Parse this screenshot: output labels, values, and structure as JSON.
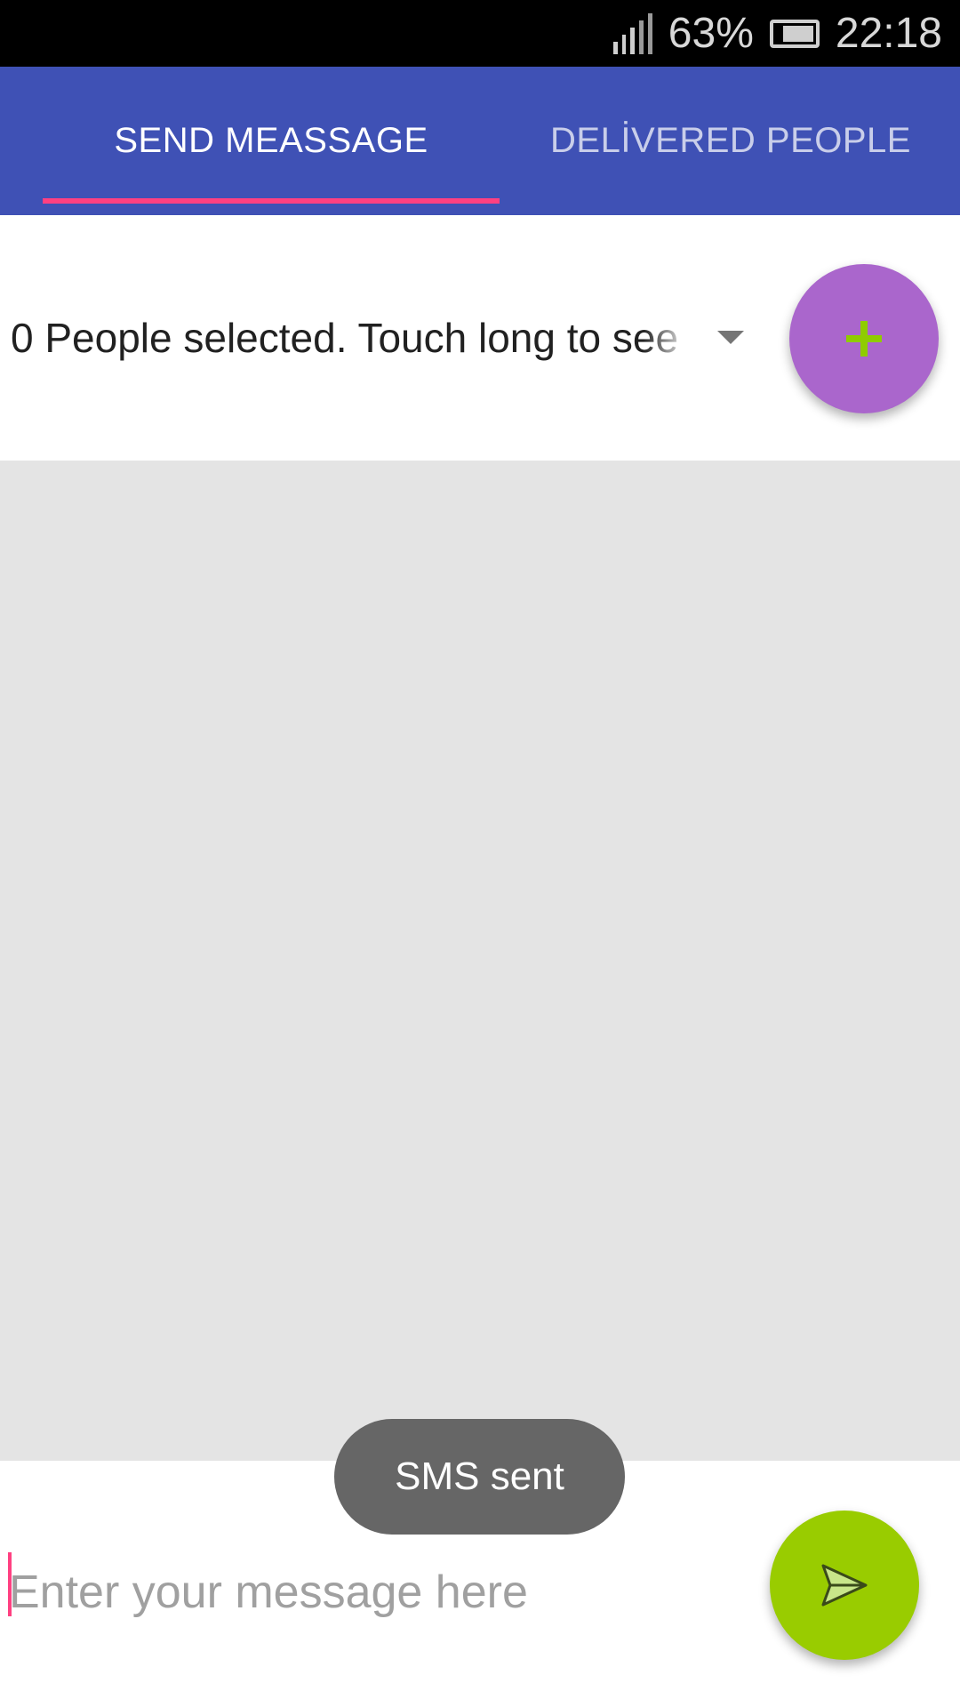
{
  "status_bar": {
    "signal_icon": "signal-bars-icon",
    "battery_percent": "63%",
    "battery_icon": "battery-icon",
    "time": "22:18"
  },
  "tabs": {
    "items": [
      {
        "label": "SEND MEASSAGE",
        "selected": true
      },
      {
        "label": "DELİVERED PEOPLE",
        "selected": false
      }
    ]
  },
  "selector": {
    "text": "0 People selected. Touch long to see",
    "dropdown_icon": "dropdown-arrow-icon",
    "add_button_icon": "plus-icon"
  },
  "composer": {
    "placeholder": "Enter your message here",
    "value": "",
    "send_button_icon": "send-icon"
  },
  "toast": {
    "text": "SMS sent"
  },
  "colors": {
    "app_bar": "#3f51b5",
    "tab_indicator": "#ff4081",
    "add_fab": "#aa66cc",
    "add_icon": "#8fcc00",
    "send_fab": "#99cc00",
    "content_bg": "#e4e4e4",
    "toast_bg": "#666666"
  }
}
